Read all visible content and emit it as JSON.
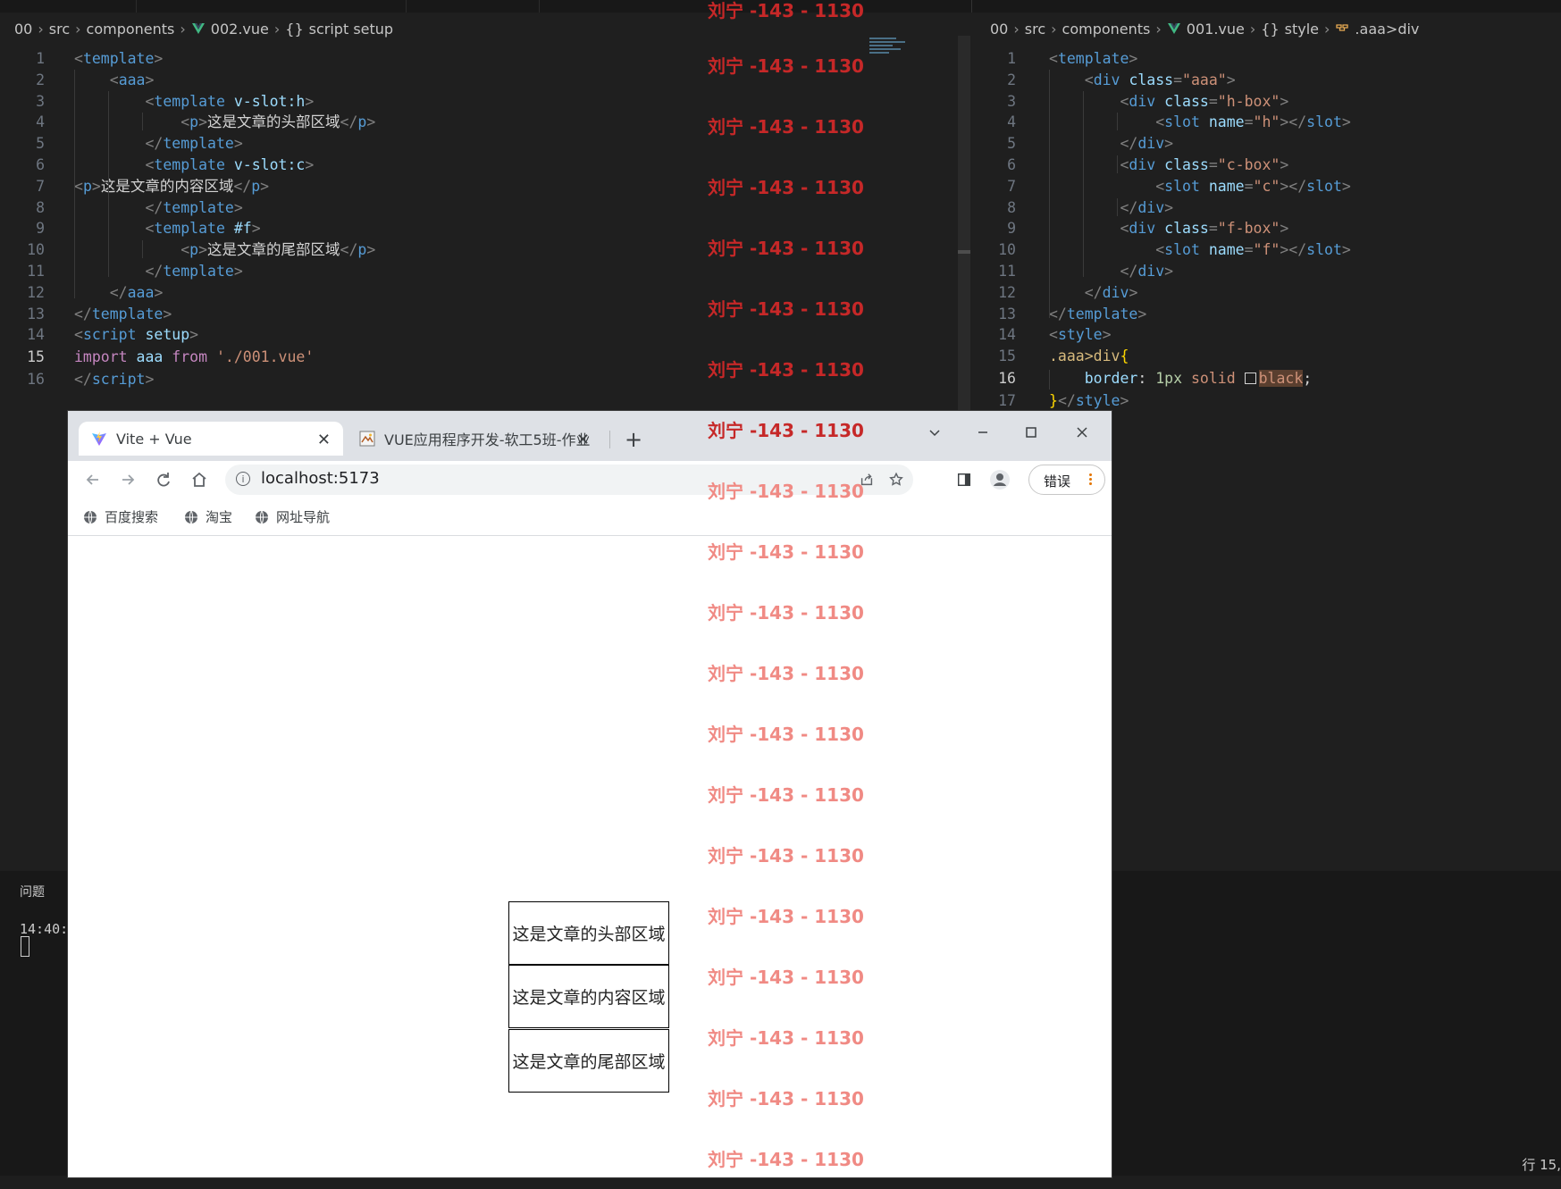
{
  "vscode": {
    "left_breadcrumb": [
      "00",
      "src",
      "components",
      "002.vue",
      "{}",
      "script setup"
    ],
    "right_breadcrumb": [
      "00",
      "src",
      "components",
      "001.vue",
      "{}",
      "style",
      ".aaa>div"
    ],
    "bottom_panel": {
      "title": "问题",
      "time": "14:40:"
    },
    "status_right": "行 15,"
  },
  "left_code": [
    {
      "num": "1",
      "html": "<span class='tk-punct'>&lt;</span><span class='tk-tag'>template</span><span class='tk-punct'>&gt;</span>"
    },
    {
      "num": "2",
      "html": "    <span class='tk-punct'>&lt;</span><span class='tk-tag'>aaa</span><span class='tk-punct'>&gt;</span>"
    },
    {
      "num": "3",
      "html": "        <span class='tk-punct'>&lt;</span><span class='tk-tag'>template</span> <span class='tk-attr'>v-slot:h</span><span class='tk-punct'>&gt;</span>"
    },
    {
      "num": "4",
      "html": "            <span class='tk-punct'>&lt;</span><span class='tk-tag'>p</span><span class='tk-punct'>&gt;</span><span class='tk-text'>这是文章的头部区域</span><span class='tk-punct'>&lt;/</span><span class='tk-tag'>p</span><span class='tk-punct'>&gt;</span>"
    },
    {
      "num": "5",
      "html": "        <span class='tk-punct'>&lt;/</span><span class='tk-tag'>template</span><span class='tk-punct'>&gt;</span>"
    },
    {
      "num": "6",
      "html": "        <span class='tk-punct'>&lt;</span><span class='tk-tag'>template</span> <span class='tk-attr'>v-slot:c</span><span class='tk-punct'>&gt;</span>"
    },
    {
      "num": "7",
      "html": "<span class='tk-punct'>&lt;</span><span class='tk-tag'>p</span><span class='tk-punct'>&gt;</span><span class='tk-text'>这是文章的内容区域</span><span class='tk-punct'>&lt;/</span><span class='tk-tag'>p</span><span class='tk-punct'>&gt;</span>"
    },
    {
      "num": "8",
      "html": "        <span class='tk-punct'>&lt;/</span><span class='tk-tag'>template</span><span class='tk-punct'>&gt;</span>"
    },
    {
      "num": "9",
      "html": "        <span class='tk-punct'>&lt;</span><span class='tk-tag'>template</span> <span class='tk-attr'>#f</span><span class='tk-punct'>&gt;</span>"
    },
    {
      "num": "10",
      "html": "            <span class='tk-punct'>&lt;</span><span class='tk-tag'>p</span><span class='tk-punct'>&gt;</span><span class='tk-text'>这是文章的尾部区域</span><span class='tk-punct'>&lt;/</span><span class='tk-tag'>p</span><span class='tk-punct'>&gt;</span>"
    },
    {
      "num": "11",
      "html": "        <span class='tk-punct'>&lt;/</span><span class='tk-tag'>template</span><span class='tk-punct'>&gt;</span>"
    },
    {
      "num": "12",
      "html": "    <span class='tk-punct'>&lt;/</span><span class='tk-tag'>aaa</span><span class='tk-punct'>&gt;</span>"
    },
    {
      "num": "13",
      "html": "<span class='tk-punct'>&lt;/</span><span class='tk-tag'>template</span><span class='tk-punct'>&gt;</span>"
    },
    {
      "num": "14",
      "html": "<span class='tk-punct'>&lt;</span><span class='tk-tag'>script</span> <span class='tk-attr'>setup</span><span class='tk-punct'>&gt;</span>"
    },
    {
      "num": "15",
      "html": "<span class='tk-kw'>import</span> <span class='tk-attr'>aaa</span> <span class='tk-kw'>from</span> <span class='tk-str'>'./001.vue'</span>",
      "active": true
    },
    {
      "num": "16",
      "html": "<span class='tk-punct'>&lt;/</span><span class='tk-tag'>script</span><span class='tk-punct'>&gt;</span>"
    }
  ],
  "right_code": [
    {
      "num": "1",
      "html": "<span class='tk-punct'>&lt;</span><span class='tk-tag'>template</span><span class='tk-punct'>&gt;</span>"
    },
    {
      "num": "2",
      "html": "    <span class='tk-punct'>&lt;</span><span class='tk-tag'>div</span> <span class='tk-attr'>class</span><span class='tk-punct'>=</span><span class='tk-str'>\"aaa\"</span><span class='tk-punct'>&gt;</span>"
    },
    {
      "num": "3",
      "html": "        <span class='tk-punct'>&lt;</span><span class='tk-tag'>div</span> <span class='tk-attr'>class</span><span class='tk-punct'>=</span><span class='tk-str'>\"h-box\"</span><span class='tk-punct'>&gt;</span>"
    },
    {
      "num": "4",
      "html": "            <span class='tk-punct'>&lt;</span><span class='tk-tag'>slot</span> <span class='tk-attr'>name</span><span class='tk-punct'>=</span><span class='tk-str'>\"h\"</span><span class='tk-punct'>&gt;&lt;/</span><span class='tk-tag'>slot</span><span class='tk-punct'>&gt;</span>"
    },
    {
      "num": "5",
      "html": "        <span class='tk-punct'>&lt;/</span><span class='tk-tag'>div</span><span class='tk-punct'>&gt;</span>"
    },
    {
      "num": "6",
      "html": "        <span class='tk-punct'>&lt;</span><span class='tk-tag'>div</span> <span class='tk-attr'>class</span><span class='tk-punct'>=</span><span class='tk-str'>\"c-box\"</span><span class='tk-punct'>&gt;</span>"
    },
    {
      "num": "7",
      "html": "            <span class='tk-punct'>&lt;</span><span class='tk-tag'>slot</span> <span class='tk-attr'>name</span><span class='tk-punct'>=</span><span class='tk-str'>\"c\"</span><span class='tk-punct'>&gt;&lt;/</span><span class='tk-tag'>slot</span><span class='tk-punct'>&gt;</span>"
    },
    {
      "num": "8",
      "html": "        <span class='tk-punct'>&lt;/</span><span class='tk-tag'>div</span><span class='tk-punct'>&gt;</span>"
    },
    {
      "num": "9",
      "html": "        <span class='tk-punct'>&lt;</span><span class='tk-tag'>div</span> <span class='tk-attr'>class</span><span class='tk-punct'>=</span><span class='tk-str'>\"f-box\"</span><span class='tk-punct'>&gt;</span>"
    },
    {
      "num": "10",
      "html": "            <span class='tk-punct'>&lt;</span><span class='tk-tag'>slot</span> <span class='tk-attr'>name</span><span class='tk-punct'>=</span><span class='tk-str'>\"f\"</span><span class='tk-punct'>&gt;&lt;/</span><span class='tk-tag'>slot</span><span class='tk-punct'>&gt;</span>"
    },
    {
      "num": "11",
      "html": "        <span class='tk-punct'>&lt;/</span><span class='tk-tag'>div</span><span class='tk-punct'>&gt;</span>"
    },
    {
      "num": "12",
      "html": "    <span class='tk-punct'>&lt;/</span><span class='tk-tag'>div</span><span class='tk-punct'>&gt;</span>"
    },
    {
      "num": "13",
      "html": "<span class='tk-punct'>&lt;/</span><span class='tk-tag'>template</span><span class='tk-punct'>&gt;</span>"
    },
    {
      "num": "14",
      "html": "<span class='tk-punct'>&lt;</span><span class='tk-tag'>style</span><span class='tk-punct'>&gt;</span>"
    },
    {
      "num": "15",
      "html": "<span class='tk-sel'>.aaa&gt;div</span><span class='tk-brace'>{</span>"
    },
    {
      "num": "16",
      "html": "    <span class='tk-prop'>border</span><span class='tk-text'>:</span> <span class='tk-num'>1px</span> <span class='tk-value'>solid</span> <span style='display:inline-block;width:11px;height:11px;border:1px solid #d4d4d4;vertical-align:-1px;margin-right:3px;'></span><span class='tk-value tk-black-bg'>black</span><span class='tk-text'>;</span>",
      "active": true
    },
    {
      "num": "17",
      "html": "<span class='tk-brace'>}</span><span class='tk-punct'>&lt;/</span><span class='tk-tag'>style</span><span class='tk-punct'>&gt;</span>"
    }
  ],
  "browser": {
    "tabs": [
      {
        "title": "Vite + Vue"
      },
      {
        "title": "VUE应用程序开发-软工5班-作业"
      }
    ],
    "url": "localhost:5173",
    "error_label": "错误",
    "bookmarks": [
      "百度搜索",
      "淘宝",
      "网址导航"
    ],
    "content_boxes": [
      "这是文章的头部区域",
      "这是文章的内容区域",
      "这是文章的尾部区域"
    ]
  },
  "watermark": {
    "text": "刘宁 -143 - 1130"
  },
  "colors": {
    "watermark_dark": "#c62828",
    "watermark_light": "#f08a84"
  }
}
